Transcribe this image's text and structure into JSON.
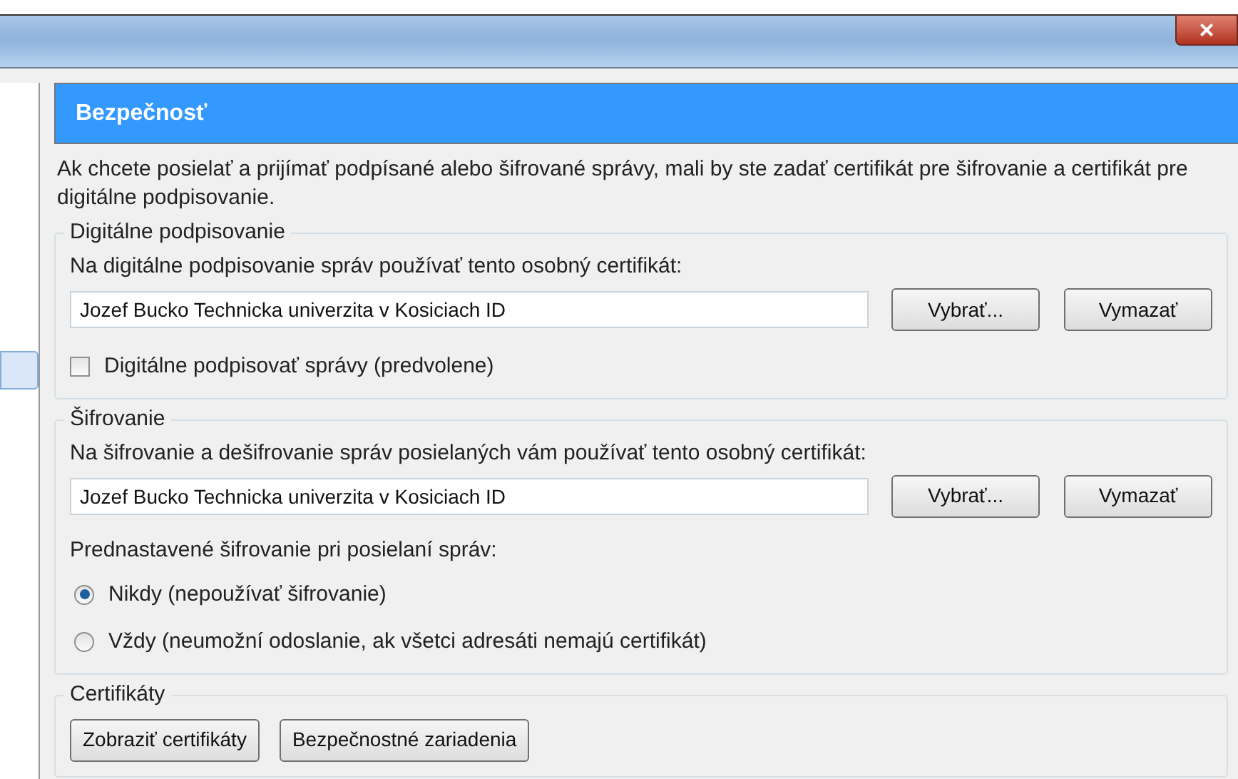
{
  "window": {
    "close": "×"
  },
  "sidebar": {
    "items": [
      {
        "selected": true
      }
    ]
  },
  "header": {
    "title": "Bezpečnosť"
  },
  "description": "Ak chcete posielať a prijímať podpísané alebo šifrované správy, mali by ste zadať certifikát pre šifrovanie a certifikát pre digitálne podpisovanie.",
  "signing": {
    "legend": "Digitálne podpisovanie",
    "label": "Na digitálne podpisovanie správ používať tento osobný certifikát:",
    "value": "Jozef Bucko Technicka univerzita v Kosiciach ID",
    "buttons": [
      "Vybrať...",
      "Vymazať"
    ],
    "checkbox": {
      "label": "Digitálne podpisovať správy (predvolene)",
      "checked": false
    }
  },
  "encryption": {
    "legend": "Šifrovanie",
    "label": "Na šifrovanie a dešifrovanie správ posielaných vám používať tento osobný certifikát:",
    "value": "Jozef Bucko Technicka univerzita v Kosiciach ID",
    "buttons": [
      "Vybrať...",
      "Vymazať"
    ],
    "default_label": "Prednastavené šifrovanie pri posielaní správ:",
    "options": [
      {
        "label": "Nikdy (nepoužívať šifrovanie)",
        "selected": true
      },
      {
        "label": "Vždy (neumožní odoslanie, ak všetci adresáti nemajú certifikát)",
        "selected": false
      }
    ]
  },
  "certificates": {
    "legend": "Certifikáty",
    "buttons": [
      "Zobraziť certifikáty",
      "Bezpečnostné zariadenia"
    ]
  }
}
